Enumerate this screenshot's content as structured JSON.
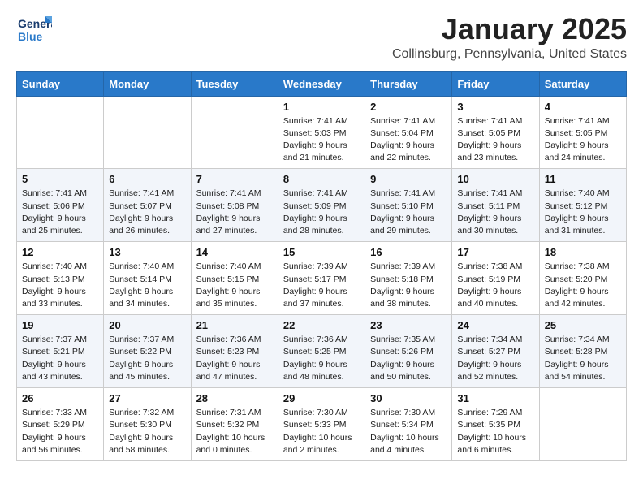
{
  "header": {
    "logo_line1": "General",
    "logo_line2": "Blue",
    "month": "January 2025",
    "location": "Collinsburg, Pennsylvania, United States"
  },
  "weekdays": [
    "Sunday",
    "Monday",
    "Tuesday",
    "Wednesday",
    "Thursday",
    "Friday",
    "Saturday"
  ],
  "weeks": [
    [
      {
        "day": "",
        "sunrise": "",
        "sunset": "",
        "daylight": ""
      },
      {
        "day": "",
        "sunrise": "",
        "sunset": "",
        "daylight": ""
      },
      {
        "day": "",
        "sunrise": "",
        "sunset": "",
        "daylight": ""
      },
      {
        "day": "1",
        "sunrise": "Sunrise: 7:41 AM",
        "sunset": "Sunset: 5:03 PM",
        "daylight": "Daylight: 9 hours and 21 minutes."
      },
      {
        "day": "2",
        "sunrise": "Sunrise: 7:41 AM",
        "sunset": "Sunset: 5:04 PM",
        "daylight": "Daylight: 9 hours and 22 minutes."
      },
      {
        "day": "3",
        "sunrise": "Sunrise: 7:41 AM",
        "sunset": "Sunset: 5:05 PM",
        "daylight": "Daylight: 9 hours and 23 minutes."
      },
      {
        "day": "4",
        "sunrise": "Sunrise: 7:41 AM",
        "sunset": "Sunset: 5:05 PM",
        "daylight": "Daylight: 9 hours and 24 minutes."
      }
    ],
    [
      {
        "day": "5",
        "sunrise": "Sunrise: 7:41 AM",
        "sunset": "Sunset: 5:06 PM",
        "daylight": "Daylight: 9 hours and 25 minutes."
      },
      {
        "day": "6",
        "sunrise": "Sunrise: 7:41 AM",
        "sunset": "Sunset: 5:07 PM",
        "daylight": "Daylight: 9 hours and 26 minutes."
      },
      {
        "day": "7",
        "sunrise": "Sunrise: 7:41 AM",
        "sunset": "Sunset: 5:08 PM",
        "daylight": "Daylight: 9 hours and 27 minutes."
      },
      {
        "day": "8",
        "sunrise": "Sunrise: 7:41 AM",
        "sunset": "Sunset: 5:09 PM",
        "daylight": "Daylight: 9 hours and 28 minutes."
      },
      {
        "day": "9",
        "sunrise": "Sunrise: 7:41 AM",
        "sunset": "Sunset: 5:10 PM",
        "daylight": "Daylight: 9 hours and 29 minutes."
      },
      {
        "day": "10",
        "sunrise": "Sunrise: 7:41 AM",
        "sunset": "Sunset: 5:11 PM",
        "daylight": "Daylight: 9 hours and 30 minutes."
      },
      {
        "day": "11",
        "sunrise": "Sunrise: 7:40 AM",
        "sunset": "Sunset: 5:12 PM",
        "daylight": "Daylight: 9 hours and 31 minutes."
      }
    ],
    [
      {
        "day": "12",
        "sunrise": "Sunrise: 7:40 AM",
        "sunset": "Sunset: 5:13 PM",
        "daylight": "Daylight: 9 hours and 33 minutes."
      },
      {
        "day": "13",
        "sunrise": "Sunrise: 7:40 AM",
        "sunset": "Sunset: 5:14 PM",
        "daylight": "Daylight: 9 hours and 34 minutes."
      },
      {
        "day": "14",
        "sunrise": "Sunrise: 7:40 AM",
        "sunset": "Sunset: 5:15 PM",
        "daylight": "Daylight: 9 hours and 35 minutes."
      },
      {
        "day": "15",
        "sunrise": "Sunrise: 7:39 AM",
        "sunset": "Sunset: 5:17 PM",
        "daylight": "Daylight: 9 hours and 37 minutes."
      },
      {
        "day": "16",
        "sunrise": "Sunrise: 7:39 AM",
        "sunset": "Sunset: 5:18 PM",
        "daylight": "Daylight: 9 hours and 38 minutes."
      },
      {
        "day": "17",
        "sunrise": "Sunrise: 7:38 AM",
        "sunset": "Sunset: 5:19 PM",
        "daylight": "Daylight: 9 hours and 40 minutes."
      },
      {
        "day": "18",
        "sunrise": "Sunrise: 7:38 AM",
        "sunset": "Sunset: 5:20 PM",
        "daylight": "Daylight: 9 hours and 42 minutes."
      }
    ],
    [
      {
        "day": "19",
        "sunrise": "Sunrise: 7:37 AM",
        "sunset": "Sunset: 5:21 PM",
        "daylight": "Daylight: 9 hours and 43 minutes."
      },
      {
        "day": "20",
        "sunrise": "Sunrise: 7:37 AM",
        "sunset": "Sunset: 5:22 PM",
        "daylight": "Daylight: 9 hours and 45 minutes."
      },
      {
        "day": "21",
        "sunrise": "Sunrise: 7:36 AM",
        "sunset": "Sunset: 5:23 PM",
        "daylight": "Daylight: 9 hours and 47 minutes."
      },
      {
        "day": "22",
        "sunrise": "Sunrise: 7:36 AM",
        "sunset": "Sunset: 5:25 PM",
        "daylight": "Daylight: 9 hours and 48 minutes."
      },
      {
        "day": "23",
        "sunrise": "Sunrise: 7:35 AM",
        "sunset": "Sunset: 5:26 PM",
        "daylight": "Daylight: 9 hours and 50 minutes."
      },
      {
        "day": "24",
        "sunrise": "Sunrise: 7:34 AM",
        "sunset": "Sunset: 5:27 PM",
        "daylight": "Daylight: 9 hours and 52 minutes."
      },
      {
        "day": "25",
        "sunrise": "Sunrise: 7:34 AM",
        "sunset": "Sunset: 5:28 PM",
        "daylight": "Daylight: 9 hours and 54 minutes."
      }
    ],
    [
      {
        "day": "26",
        "sunrise": "Sunrise: 7:33 AM",
        "sunset": "Sunset: 5:29 PM",
        "daylight": "Daylight: 9 hours and 56 minutes."
      },
      {
        "day": "27",
        "sunrise": "Sunrise: 7:32 AM",
        "sunset": "Sunset: 5:30 PM",
        "daylight": "Daylight: 9 hours and 58 minutes."
      },
      {
        "day": "28",
        "sunrise": "Sunrise: 7:31 AM",
        "sunset": "Sunset: 5:32 PM",
        "daylight": "Daylight: 10 hours and 0 minutes."
      },
      {
        "day": "29",
        "sunrise": "Sunrise: 7:30 AM",
        "sunset": "Sunset: 5:33 PM",
        "daylight": "Daylight: 10 hours and 2 minutes."
      },
      {
        "day": "30",
        "sunrise": "Sunrise: 7:30 AM",
        "sunset": "Sunset: 5:34 PM",
        "daylight": "Daylight: 10 hours and 4 minutes."
      },
      {
        "day": "31",
        "sunrise": "Sunrise: 7:29 AM",
        "sunset": "Sunset: 5:35 PM",
        "daylight": "Daylight: 10 hours and 6 minutes."
      },
      {
        "day": "",
        "sunrise": "",
        "sunset": "",
        "daylight": ""
      }
    ]
  ]
}
